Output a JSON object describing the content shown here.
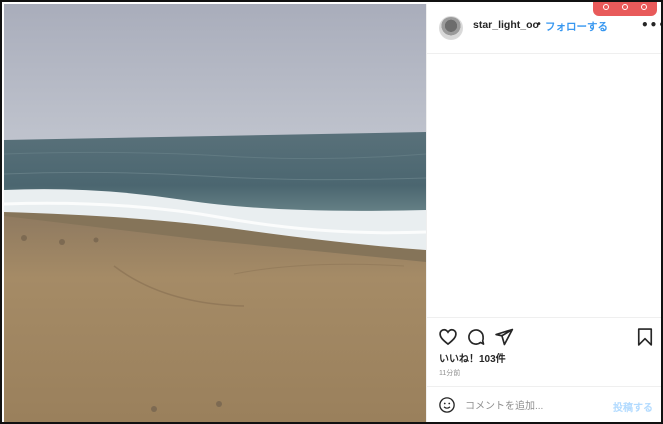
{
  "post": {
    "image": {
      "subject": "beach-sea-photo"
    },
    "user": {
      "username": "star_light_oo",
      "separator": "•",
      "follow_label": "フォローする"
    },
    "more_icon": "more-horizontal-icon",
    "likes_text": "いいね！103件",
    "time_text": "11分前",
    "comment": {
      "placeholder": "コメントを追加...",
      "value": "",
      "post_label": "投稿する"
    },
    "icons": {
      "like": "heart-icon",
      "comment": "comment-bubble-icon",
      "share": "paper-plane-icon",
      "save": "bookmark-icon",
      "emoji": "emoji-smile-icon"
    }
  },
  "colors": {
    "link_blue": "#3797f0",
    "post_disabled": "#b3dbff",
    "overlay_red": "#e85a5a",
    "sky": "#aeb3c0",
    "sea": "#4f6a73",
    "sand": "#9c8462"
  }
}
